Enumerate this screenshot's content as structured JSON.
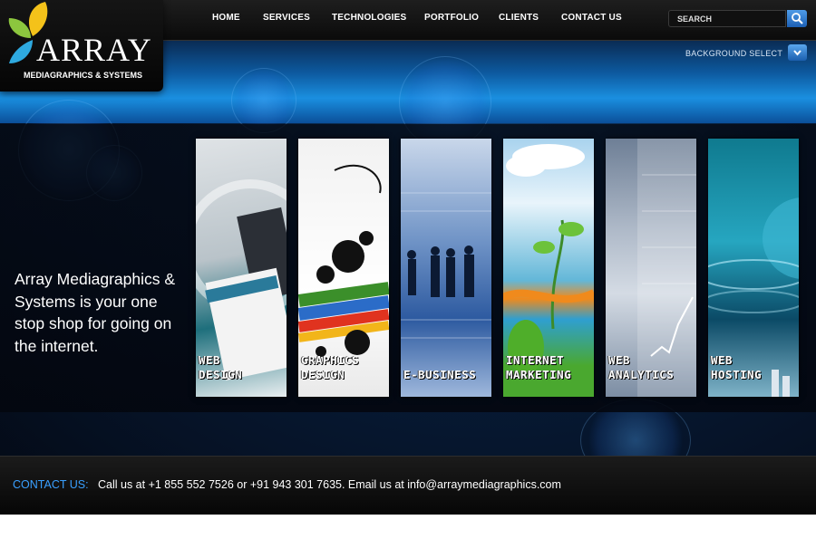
{
  "logo": {
    "word": "ARRAY",
    "subtitle": "MEDIAGRAPHICS & SYSTEMS"
  },
  "nav": {
    "home": "HOME",
    "services": "SERVICES",
    "technologies": "TECHNOLOGIES",
    "portfolio": "PORTFOLIO",
    "clients": "CLIENTS",
    "contact": "CONTACT US"
  },
  "search": {
    "placeholder": "SEARCH"
  },
  "background_select": {
    "label": "BACKGROUND SELECT"
  },
  "hero": {
    "tagline": "Array Mediagraphics & Systems is your one stop shop for going on the internet."
  },
  "services": [
    {
      "label": "WEB\nDESIGN"
    },
    {
      "label": "GRAPHICS\nDESIGN"
    },
    {
      "label": "E-BUSINESS"
    },
    {
      "label": "INTERNET\nMARKETING"
    },
    {
      "label": "WEB\nANALYTICS"
    },
    {
      "label": "WEB\nHOSTING"
    }
  ],
  "footer": {
    "contact_label": "CONTACT US:",
    "contact_text": "Call us at  +1 855 552 7526  or  +91 943 301 7635.  Email us at   info@arraymediagraphics.com"
  },
  "colors": {
    "accent": "#3aa0ff",
    "background": "#071a35"
  },
  "icons": {
    "search": "magnifier-icon",
    "background_select": "chevron-down-icon",
    "logo": "leaf-icon"
  }
}
